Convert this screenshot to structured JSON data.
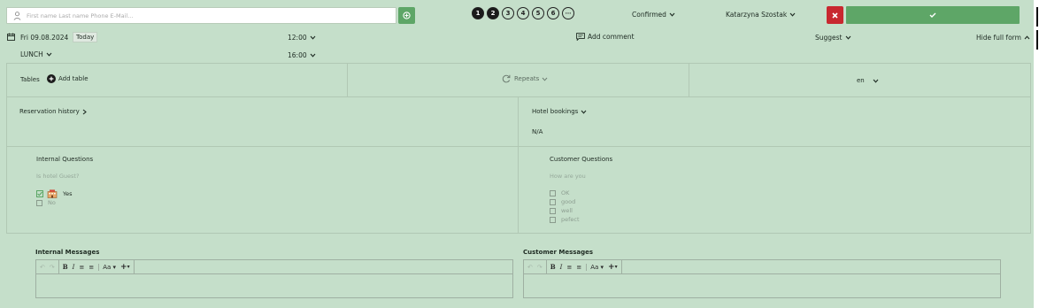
{
  "search": {
    "placeholder": "First name Last name Phone E-Mail...",
    "value": ""
  },
  "add_guest_icon": "plus-circle-icon",
  "steps": [
    {
      "label": "1",
      "state": "filled"
    },
    {
      "label": "2",
      "state": "filled"
    },
    {
      "label": "3",
      "state": "outline"
    },
    {
      "label": "4",
      "state": "outline"
    },
    {
      "label": "5",
      "state": "outline"
    },
    {
      "label": "6",
      "state": "outline"
    },
    {
      "label": "···",
      "state": "outline"
    }
  ],
  "status": {
    "label": "Confirmed"
  },
  "staff": {
    "label": "Katarzyna Szostak"
  },
  "colors": {
    "background": "#c5dfca",
    "accent_green": "#5ea667",
    "cancel_red": "#c8282f",
    "step_filled": "#1b1b1b"
  },
  "date_row": {
    "date": "Fri 09.08.2024",
    "today_label": "Today",
    "start_time": "12:00",
    "end_time": "16:00",
    "meal": "LUNCH",
    "add_comment": "Add comment",
    "suggest": "Suggest",
    "hide_form": "Hide full form"
  },
  "tables": {
    "label": "Tables",
    "add_table": "Add table"
  },
  "repeats": {
    "label": "Repeats"
  },
  "language": {
    "value": "en"
  },
  "reservation_history": {
    "label": "Reservation history"
  },
  "hotel_bookings": {
    "label": "Hotel bookings",
    "value": "N/A"
  },
  "internal_questions": {
    "title": "Internal Questions",
    "question": "Is hotel Guest?",
    "options": [
      {
        "label": "Yes",
        "checked": true
      },
      {
        "label": "No",
        "checked": false
      }
    ]
  },
  "customer_questions": {
    "title": "Customer Questions",
    "question": "How are you",
    "options": [
      {
        "label": "OK",
        "checked": false
      },
      {
        "label": "good",
        "checked": false
      },
      {
        "label": "well",
        "checked": false
      },
      {
        "label": "pefect",
        "checked": false
      }
    ]
  },
  "internal_messages": {
    "label": "Internal Messages"
  },
  "customer_messages": {
    "label": "Customer Messages"
  },
  "editor_toolbar": {
    "bold": "B",
    "italic": "I",
    "font_size": "Aa"
  }
}
